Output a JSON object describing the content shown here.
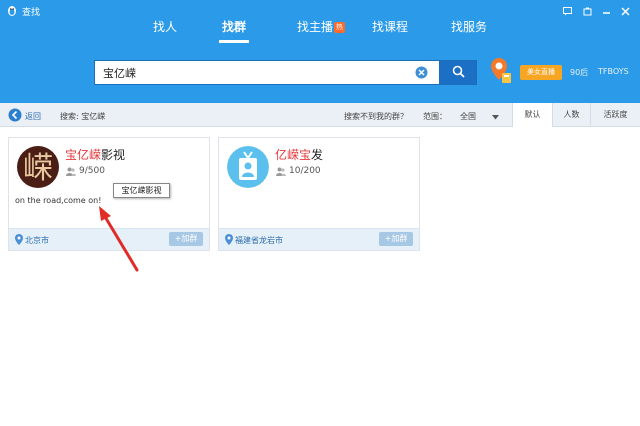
{
  "window": {
    "title": "查找"
  },
  "nav": {
    "tabs": [
      {
        "label": "找人"
      },
      {
        "label": "找群"
      },
      {
        "label": "找主播",
        "badge": "热"
      },
      {
        "label": "找课程"
      },
      {
        "label": "找服务"
      }
    ],
    "active_tab": "找群"
  },
  "search": {
    "value": "宝亿嵘"
  },
  "promo": {
    "live_badge": "美女直播",
    "keywords": [
      "90后",
      "TFBOYS"
    ]
  },
  "toolbar": {
    "back_label": "返回",
    "search_summary": "搜索: 宝亿嵘",
    "not_found_link": "搜索不到我的群？",
    "range_label": "范围：",
    "range_value": "全国",
    "sort_tabs": [
      "默认",
      "人数",
      "活跃度"
    ],
    "active_sort": "默认"
  },
  "results": [
    {
      "name_highlight": "宝亿嵘",
      "name_rest": "影视",
      "members": "9/500",
      "description": "on the road,come on!",
      "location": "北京市",
      "join_label": "+加群",
      "tooltip": "宝亿嵘影视",
      "avatar_glyph": "嵘"
    },
    {
      "name_highlight": "亿嵘宝",
      "name_rest": "发",
      "members": "10/200",
      "description": "",
      "location": "福建省龙岩市",
      "join_label": "+加群"
    }
  ],
  "colors": {
    "header_bg": "#2b9ae8",
    "search_button": "#1b6fc4",
    "highlight": "#e4393c",
    "annotation_arrow": "#e02b27"
  }
}
